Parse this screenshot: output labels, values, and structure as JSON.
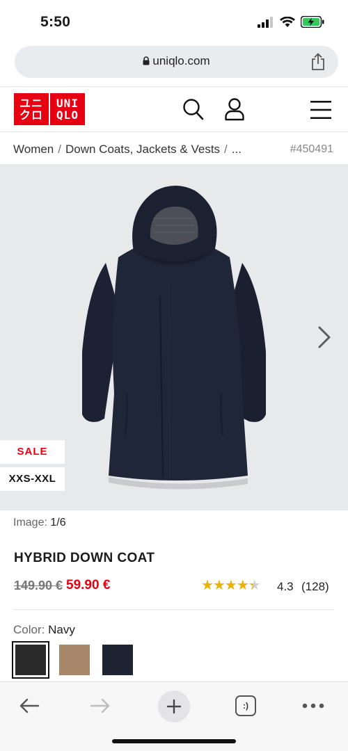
{
  "status_bar": {
    "time": "5:50"
  },
  "browser": {
    "url": "uniqlo.com",
    "toolbar": {
      "back": "back-arrow-icon",
      "forward": "forward-arrow-icon",
      "new_tab": "plus-icon",
      "tabs_label": ":)",
      "more": "more-dots-icon"
    }
  },
  "header": {
    "logo_top": "ユニ",
    "logo_top_right": "UNI",
    "logo_bottom": "クロ",
    "logo_bottom_right": "QLO"
  },
  "breadcrumb": {
    "items": [
      "Women",
      "Down Coats, Jackets & Vests",
      "..."
    ],
    "product_id": "#450491"
  },
  "gallery": {
    "badges": {
      "sale": "SALE",
      "sizes": "XXS-XXL"
    },
    "counter_label": "Image:",
    "counter_value": "1/6"
  },
  "product": {
    "title": "HYBRID DOWN COAT",
    "price_old": "149.90 €",
    "price_new": "59.90 €",
    "rating": "4.3",
    "rating_value": 4.3,
    "review_count": "(128)"
  },
  "colors": {
    "label": "Color:",
    "selected": "Navy",
    "swatches": [
      {
        "name": "black",
        "hex": "#2a2a2a",
        "selected": true
      },
      {
        "name": "beige",
        "hex": "#a8866a",
        "selected": false
      },
      {
        "name": "navy",
        "hex": "#1f2433",
        "selected": false
      }
    ]
  },
  "theme": {
    "brand_red": "#e60012",
    "star_color": "#e8b400"
  }
}
